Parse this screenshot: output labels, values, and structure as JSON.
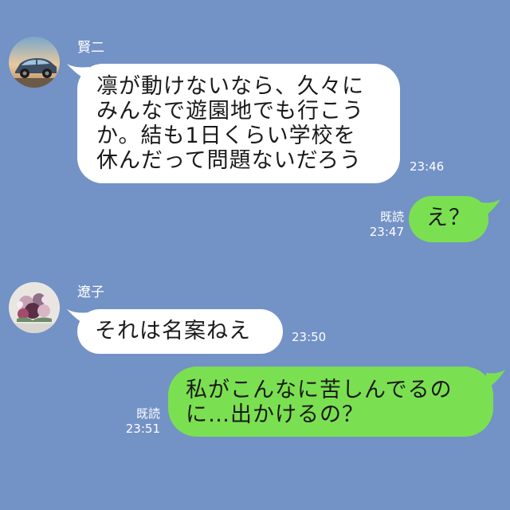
{
  "messages": [
    {
      "sender": "賢二",
      "side": "left",
      "text": "凛が動けないなら、久々に\nみんなで遊園地でも行こう\nか。結も1日くらい学校を\n休んだって問題ないだろう",
      "time": "23:46"
    },
    {
      "side": "right",
      "text": "え？",
      "read_label": "既読",
      "time": "23:47"
    },
    {
      "sender": "遼子",
      "side": "left",
      "text": "それは名案ねえ",
      "time": "23:50"
    },
    {
      "side": "right",
      "text": "私がこんなに苦しんでるの\nに…出かけるの？",
      "read_label": "既読",
      "time": "23:51"
    }
  ],
  "colors": {
    "background": "#7392c6",
    "incoming_bubble": "#ffffff",
    "outgoing_bubble": "#7be051",
    "meta_text": "#ffffff"
  },
  "icons": {
    "avatar_kenji": "car-photo-avatar",
    "avatar_ryoko": "flower-bouquet-avatar"
  }
}
